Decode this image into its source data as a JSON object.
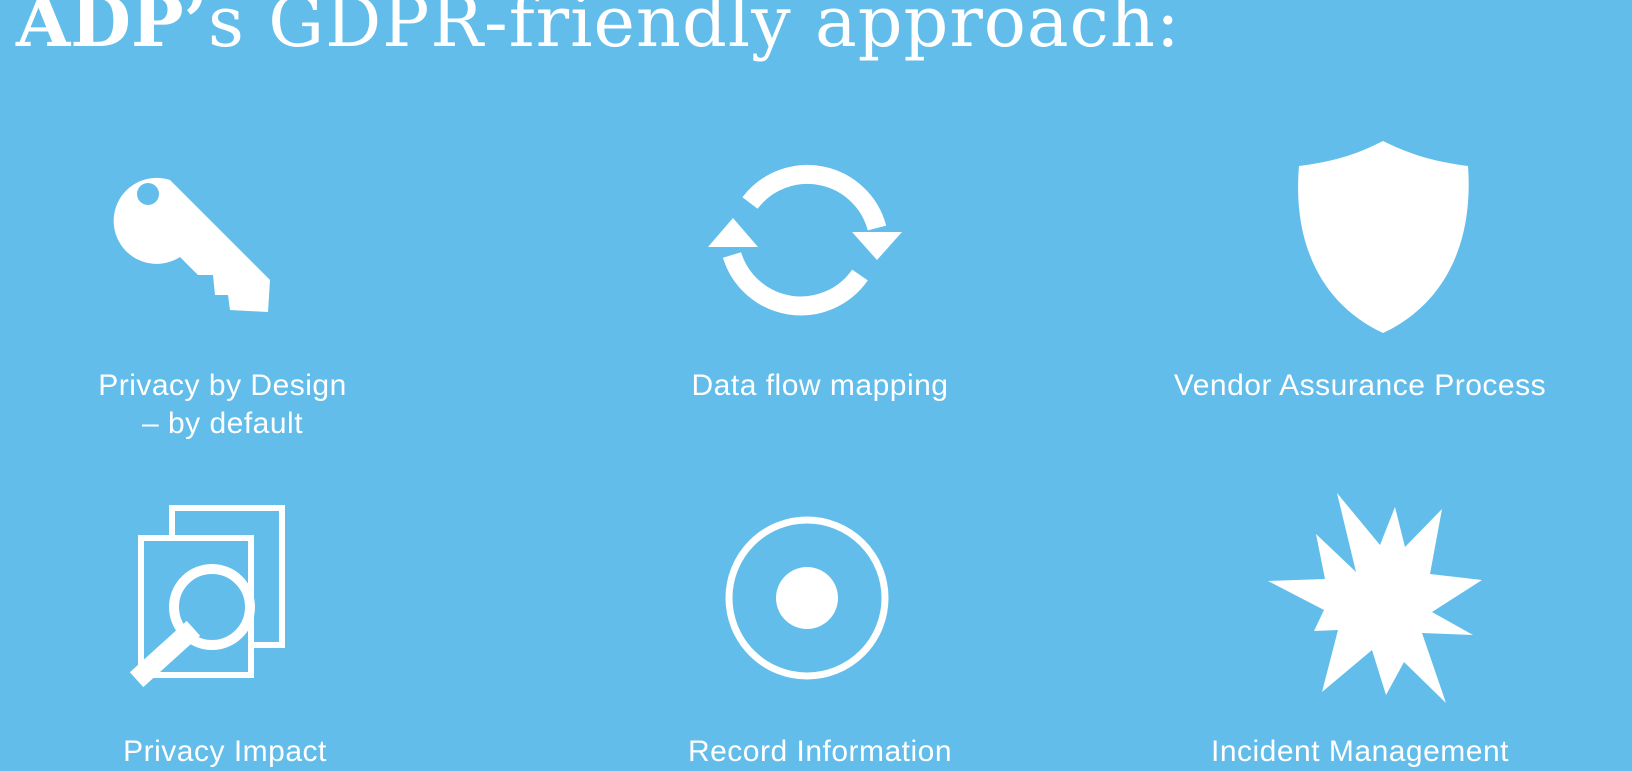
{
  "title": {
    "brand": "ADP’",
    "rest": "s GDPR-friendly approach:"
  },
  "items": [
    {
      "line1": "Privacy by Design",
      "line2": "– by default",
      "icon": "key-icon"
    },
    {
      "line1": "Data flow mapping",
      "line2": "",
      "icon": "sync-icon"
    },
    {
      "line1": "Vendor Assurance Process",
      "line2": "",
      "icon": "shield-icon"
    },
    {
      "line1": "Privacy Impact",
      "line2": "",
      "icon": "document-search-icon"
    },
    {
      "line1": "Record Information",
      "line2": "",
      "icon": "target-icon"
    },
    {
      "line1": "Incident Management",
      "line2": "",
      "icon": "burst-icon"
    }
  ],
  "colors": {
    "background": "#63bdea",
    "foreground": "#ffffff"
  }
}
